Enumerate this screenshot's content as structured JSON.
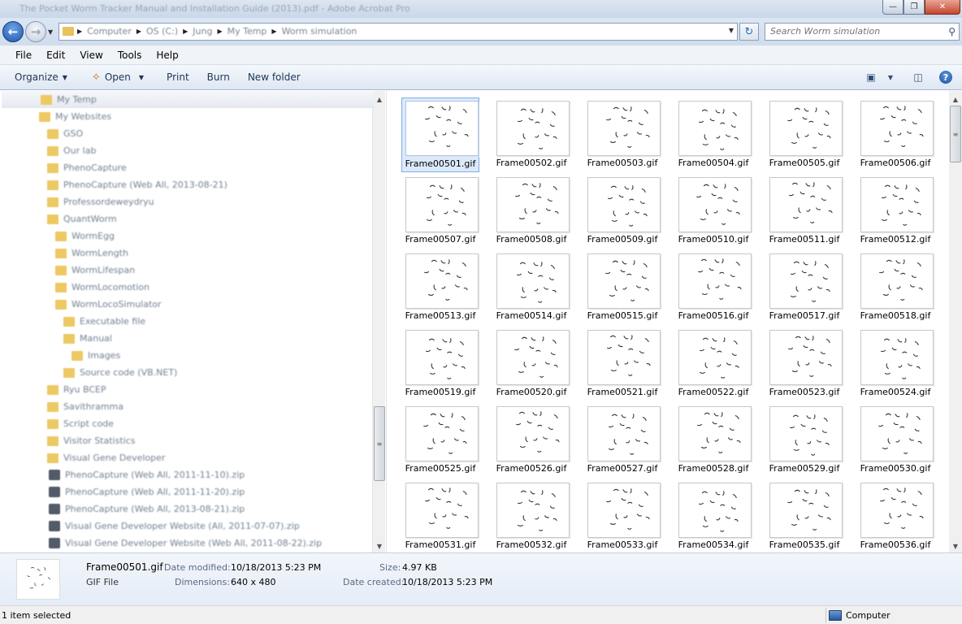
{
  "window": {
    "title": "The Pocket Worm Tracker Manual and Installation Guide (2013).pdf - Adobe Acrobat Pro",
    "controls": {
      "minimize": "—",
      "maximize": "❐",
      "close": "✕"
    }
  },
  "address": {
    "crumbs": [
      "Computer",
      "OS (C:)",
      "Jung",
      "My Temp",
      "Worm simulation"
    ],
    "search_placeholder": "Search Worm simulation"
  },
  "menu": [
    "File",
    "Edit",
    "View",
    "Tools",
    "Help"
  ],
  "commands": {
    "organize": "Organize",
    "open": "Open",
    "print": "Print",
    "burn": "Burn",
    "new_folder": "New folder"
  },
  "tree": [
    {
      "label": "My Temp",
      "kind": "folder",
      "level": 0,
      "selected": true
    },
    {
      "label": "My Websites",
      "kind": "folder",
      "level": 0
    },
    {
      "label": "GSO",
      "kind": "folder",
      "level": 1
    },
    {
      "label": "Our lab",
      "kind": "folder",
      "level": 1
    },
    {
      "label": "PhenoCapture",
      "kind": "folder",
      "level": 1
    },
    {
      "label": "PhenoCapture (Web All, 2013-08-21)",
      "kind": "folder",
      "level": 1
    },
    {
      "label": "Professordeweydryu",
      "kind": "folder",
      "level": 1
    },
    {
      "label": "QuantWorm",
      "kind": "folder",
      "level": 1
    },
    {
      "label": "WormEgg",
      "kind": "folder",
      "level": 2
    },
    {
      "label": "WormLength",
      "kind": "folder",
      "level": 2
    },
    {
      "label": "WormLifespan",
      "kind": "folder",
      "level": 2
    },
    {
      "label": "WormLocomotion",
      "kind": "folder",
      "level": 2
    },
    {
      "label": "WormLocoSimulator",
      "kind": "folder",
      "level": 2
    },
    {
      "label": "Executable file",
      "kind": "folder",
      "level": 3
    },
    {
      "label": "Manual",
      "kind": "folder",
      "level": 3
    },
    {
      "label": "Images",
      "kind": "folder",
      "level": 4
    },
    {
      "label": "Source code (VB.NET)",
      "kind": "folder",
      "level": 3
    },
    {
      "label": "Ryu BCEP",
      "kind": "folder",
      "level": 1
    },
    {
      "label": "Savithramma",
      "kind": "folder",
      "level": 1
    },
    {
      "label": "Script code",
      "kind": "folder",
      "level": 1
    },
    {
      "label": "Visitor Statistics",
      "kind": "folder",
      "level": 1
    },
    {
      "label": "Visual Gene Developer",
      "kind": "folder",
      "level": 1
    },
    {
      "label": "PhenoCapture (Web All, 2011-11-10).zip",
      "kind": "zip",
      "level": 0
    },
    {
      "label": "PhenoCapture (Web All, 2011-11-20).zip",
      "kind": "zip",
      "level": 0
    },
    {
      "label": "PhenoCapture (Web All, 2013-08-21).zip",
      "kind": "zip",
      "level": 0
    },
    {
      "label": "Visual Gene Developer Website (All, 2011-07-07).zip",
      "kind": "zip",
      "level": 0
    },
    {
      "label": "Visual Gene Developer Website (Web All, 2011-08-22).zip",
      "kind": "zip",
      "level": 0
    }
  ],
  "files": [
    "Frame00501.gif",
    "Frame00502.gif",
    "Frame00503.gif",
    "Frame00504.gif",
    "Frame00505.gif",
    "Frame00506.gif",
    "Frame00507.gif",
    "Frame00508.gif",
    "Frame00509.gif",
    "Frame00510.gif",
    "Frame00511.gif",
    "Frame00512.gif",
    "Frame00513.gif",
    "Frame00514.gif",
    "Frame00515.gif",
    "Frame00516.gif",
    "Frame00517.gif",
    "Frame00518.gif",
    "Frame00519.gif",
    "Frame00520.gif",
    "Frame00521.gif",
    "Frame00522.gif",
    "Frame00523.gif",
    "Frame00524.gif",
    "Frame00525.gif",
    "Frame00526.gif",
    "Frame00527.gif",
    "Frame00528.gif",
    "Frame00529.gif",
    "Frame00530.gif",
    "Frame00531.gif",
    "Frame00532.gif",
    "Frame00533.gif",
    "Frame00534.gif",
    "Frame00535.gif",
    "Frame00536.gif"
  ],
  "selected_file_index": 0,
  "details": {
    "name": "Frame00501.gif",
    "type": "GIF File",
    "date_modified_label": "Date modified:",
    "date_modified": "10/18/2013 5:23 PM",
    "dimensions_label": "Dimensions:",
    "dimensions": "640 x 480",
    "size_label": "Size:",
    "size": "4.97 KB",
    "date_created_label": "Date created:",
    "date_created": "10/18/2013 5:23 PM"
  },
  "status": {
    "selection": "1 item selected",
    "location": "Computer"
  }
}
